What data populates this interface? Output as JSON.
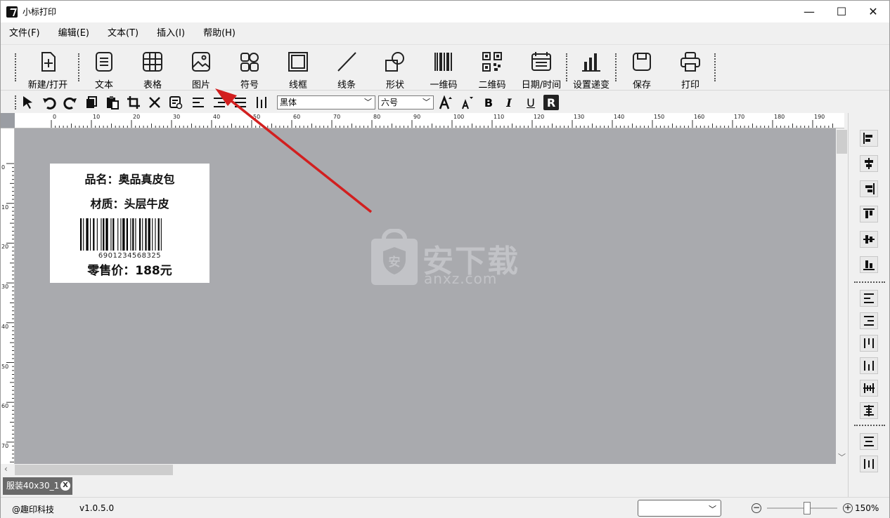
{
  "window": {
    "title": "小标打印",
    "minimize": "—",
    "maximize": "☐",
    "close": "✕"
  },
  "menu": [
    "文件(F)",
    "编辑(E)",
    "文本(T)",
    "插入(I)",
    "帮助(H)"
  ],
  "toolbar": {
    "new_open": "新建/打开",
    "text": "文本",
    "table": "表格",
    "image": "图片",
    "symbol": "符号",
    "frame": "线框",
    "line": "线条",
    "shape": "形状",
    "barcode": "一维码",
    "qrcode": "二维码",
    "datetime": "日期/时间",
    "increment": "设置递变",
    "save": "保存",
    "print": "打印"
  },
  "format_bar": {
    "font": "黑体",
    "size": "六号",
    "bold": "B",
    "italic": "I",
    "underline": "U",
    "reverse": "R"
  },
  "ruler": {
    "top": [
      "0",
      "10",
      "20",
      "30",
      "40",
      "50",
      "60",
      "70",
      "80",
      "90",
      "100",
      "110",
      "120",
      "130",
      "140",
      "150",
      "160",
      "170",
      "180",
      "190"
    ],
    "left": [
      "0",
      "10",
      "20",
      "30",
      "40",
      "50",
      "60",
      "70"
    ]
  },
  "label": {
    "product": "品名：奥品真皮包",
    "material": "材质：头层牛皮",
    "barcode_number": "6901234568325",
    "price": "零售价：188元"
  },
  "watermark": {
    "text": "安下载",
    "url": "anxz.com",
    "badge": "安"
  },
  "document_tab": {
    "name": "服装40x30_1",
    "close": "X"
  },
  "status": {
    "company": "@趣印科技",
    "version": "v1.0.5.0",
    "zoom": "150%"
  }
}
